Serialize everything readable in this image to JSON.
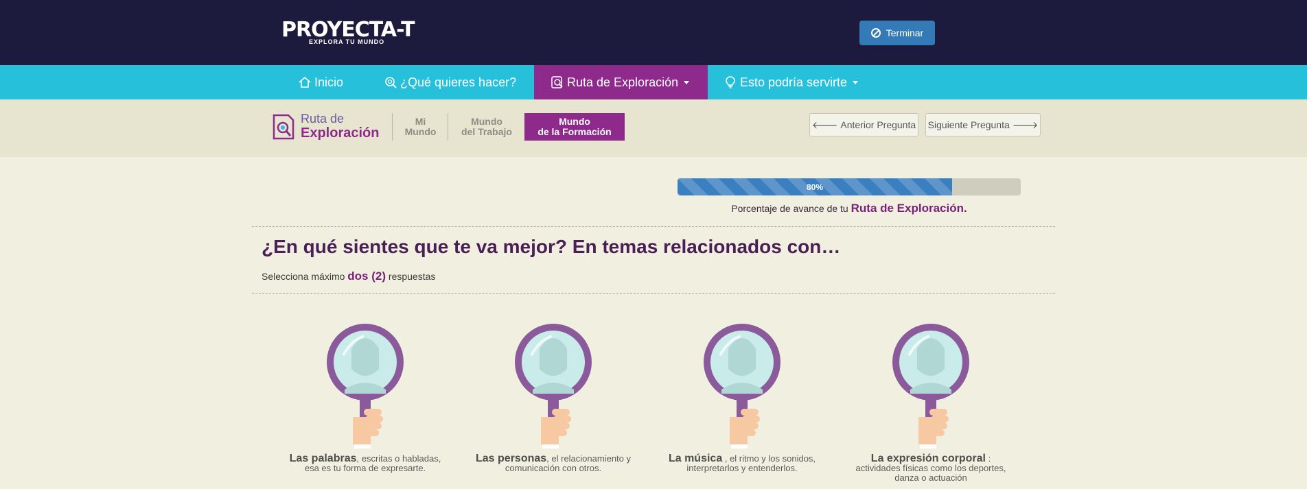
{
  "header": {
    "logo_text": "PROYECTA-T",
    "logo_tagline": "EXPLORA TU MUNDO",
    "terminar_label": "Terminar"
  },
  "nav": {
    "items": [
      {
        "label": "Inicio",
        "icon": "home-icon"
      },
      {
        "label": "¿Qué quieres hacer?",
        "icon": "search-icon"
      },
      {
        "label": "Ruta de Exploración",
        "icon": "magnifier-page-icon",
        "active": true,
        "dropdown": true
      },
      {
        "label": "Esto podría servirte",
        "icon": "lightbulb-icon",
        "dropdown": true
      }
    ]
  },
  "subnav": {
    "brand_line1": "Ruta de",
    "brand_line2": "Exploración",
    "tabs": [
      {
        "line1": "Mi",
        "line2": "Mundo"
      },
      {
        "line1": "Mundo",
        "line2": "del Trabajo"
      },
      {
        "line1": "Mundo",
        "line2": "de la Formación",
        "active": true
      }
    ],
    "prev_label": "Anterior Pregunta",
    "next_label": "Siguiente Pregunta"
  },
  "progress": {
    "value": 80,
    "label": "80%",
    "caption_prefix": "Porcentaje de avance de tu",
    "caption_strong": "Ruta de Exploración."
  },
  "question": {
    "title": "¿En qué sientes que te va mejor? En temas relacionados con…",
    "instruction_prefix": "Selecciona máximo",
    "instruction_strong": "dos (2)",
    "instruction_suffix": "respuestas"
  },
  "options": [
    {
      "title": "Las palabras",
      "desc": ", escritas o habladas, esa es tu forma de expresarte."
    },
    {
      "title": "Las personas",
      "desc": ", el relacionamiento y comunicación con otros."
    },
    {
      "title": "La música",
      "desc": " , el ritmo y los sonidos, interpretarlos y entenderlos."
    },
    {
      "title": "La expresión corporal",
      "desc": " : actividades físicas como los deportes, danza o actuación"
    }
  ],
  "colors": {
    "header_bg": "#1c1b3d",
    "nav_bg": "#27c0da",
    "accent_purple": "#8e2a8b",
    "button_blue": "#337ab7",
    "page_bg": "#f1efe0"
  }
}
